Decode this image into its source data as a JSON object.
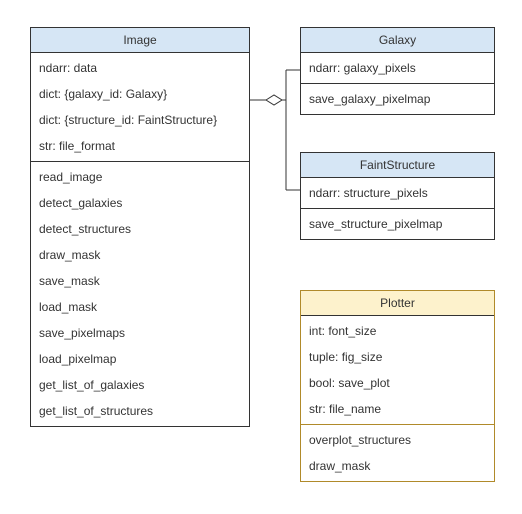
{
  "diagram": {
    "classes": {
      "image": {
        "name": "Image",
        "attributes": [
          "ndarr: data",
          "dict: {galaxy_id: Galaxy}",
          "dict: {structure_id: FaintStructure}",
          "str: file_format"
        ],
        "methods": [
          "read_image",
          "detect_galaxies",
          "detect_structures",
          "draw_mask",
          "save_mask",
          "load_mask",
          "save_pixelmaps",
          "load_pixelmap",
          "get_list_of_galaxies",
          "get_list_of_structures"
        ]
      },
      "galaxy": {
        "name": "Galaxy",
        "attributes": [
          "ndarr: galaxy_pixels"
        ],
        "methods": [
          "save_galaxy_pixelmap"
        ]
      },
      "faintstructure": {
        "name": "FaintStructure",
        "attributes": [
          "ndarr: structure_pixels"
        ],
        "methods": [
          "save_structure_pixelmap"
        ]
      },
      "plotter": {
        "name": "Plotter",
        "attributes": [
          "int: font_size",
          "tuple: fig_size",
          "bool: save_plot",
          "str: file_name"
        ],
        "methods": [
          "overplot_structures",
          "draw_mask"
        ]
      }
    },
    "relations": [
      {
        "from": "Image",
        "to": "Galaxy",
        "type": "aggregation"
      },
      {
        "from": "Image",
        "to": "FaintStructure",
        "type": "aggregation"
      }
    ]
  }
}
